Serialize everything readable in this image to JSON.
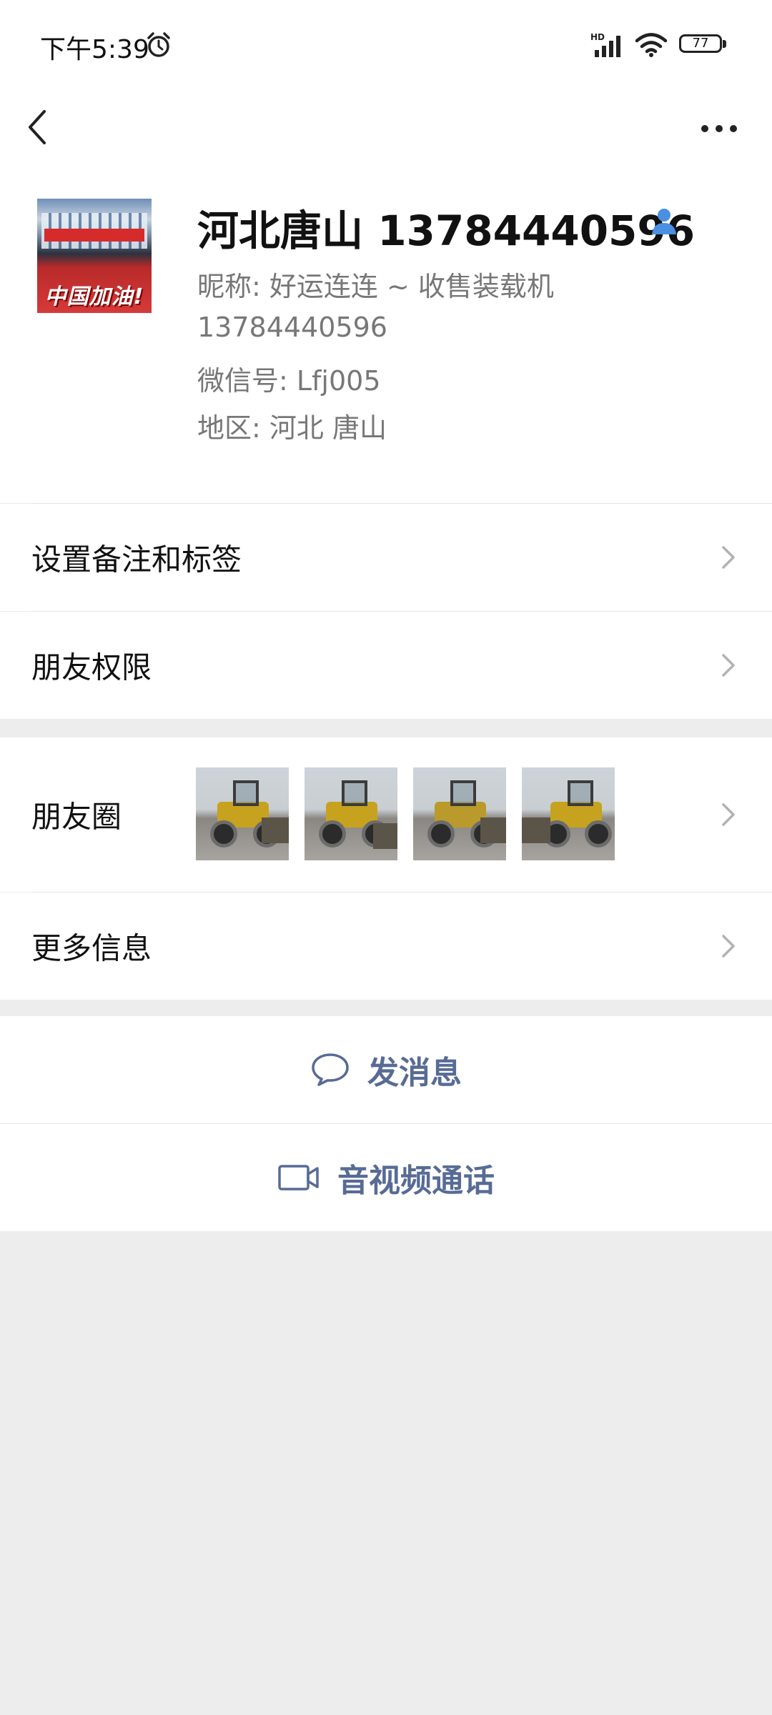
{
  "status_bar": {
    "time": "下午5:39",
    "battery": "77",
    "network_label": "HD"
  },
  "nav": {
    "back_icon": "back-chevron-icon",
    "more_icon": "more-dots-icon"
  },
  "profile": {
    "avatar_text": "中国加油!",
    "name": "河北唐山 13784440596",
    "nickname": "昵称:  好运连连 ~ 收售装载机",
    "phone": "13784440596",
    "wechat_id": "微信号:  Lfj005",
    "region": "地区:  河北  唐山"
  },
  "rows": {
    "remark": "设置备注和标签",
    "permissions": "朋友权限",
    "moments": "朋友圈",
    "more_info": "更多信息"
  },
  "actions": {
    "message": "发消息",
    "call": "音视频通话"
  },
  "colors": {
    "link_blue": "#576b95",
    "background": "#ededed",
    "contact_icon": "#4a90e2"
  }
}
